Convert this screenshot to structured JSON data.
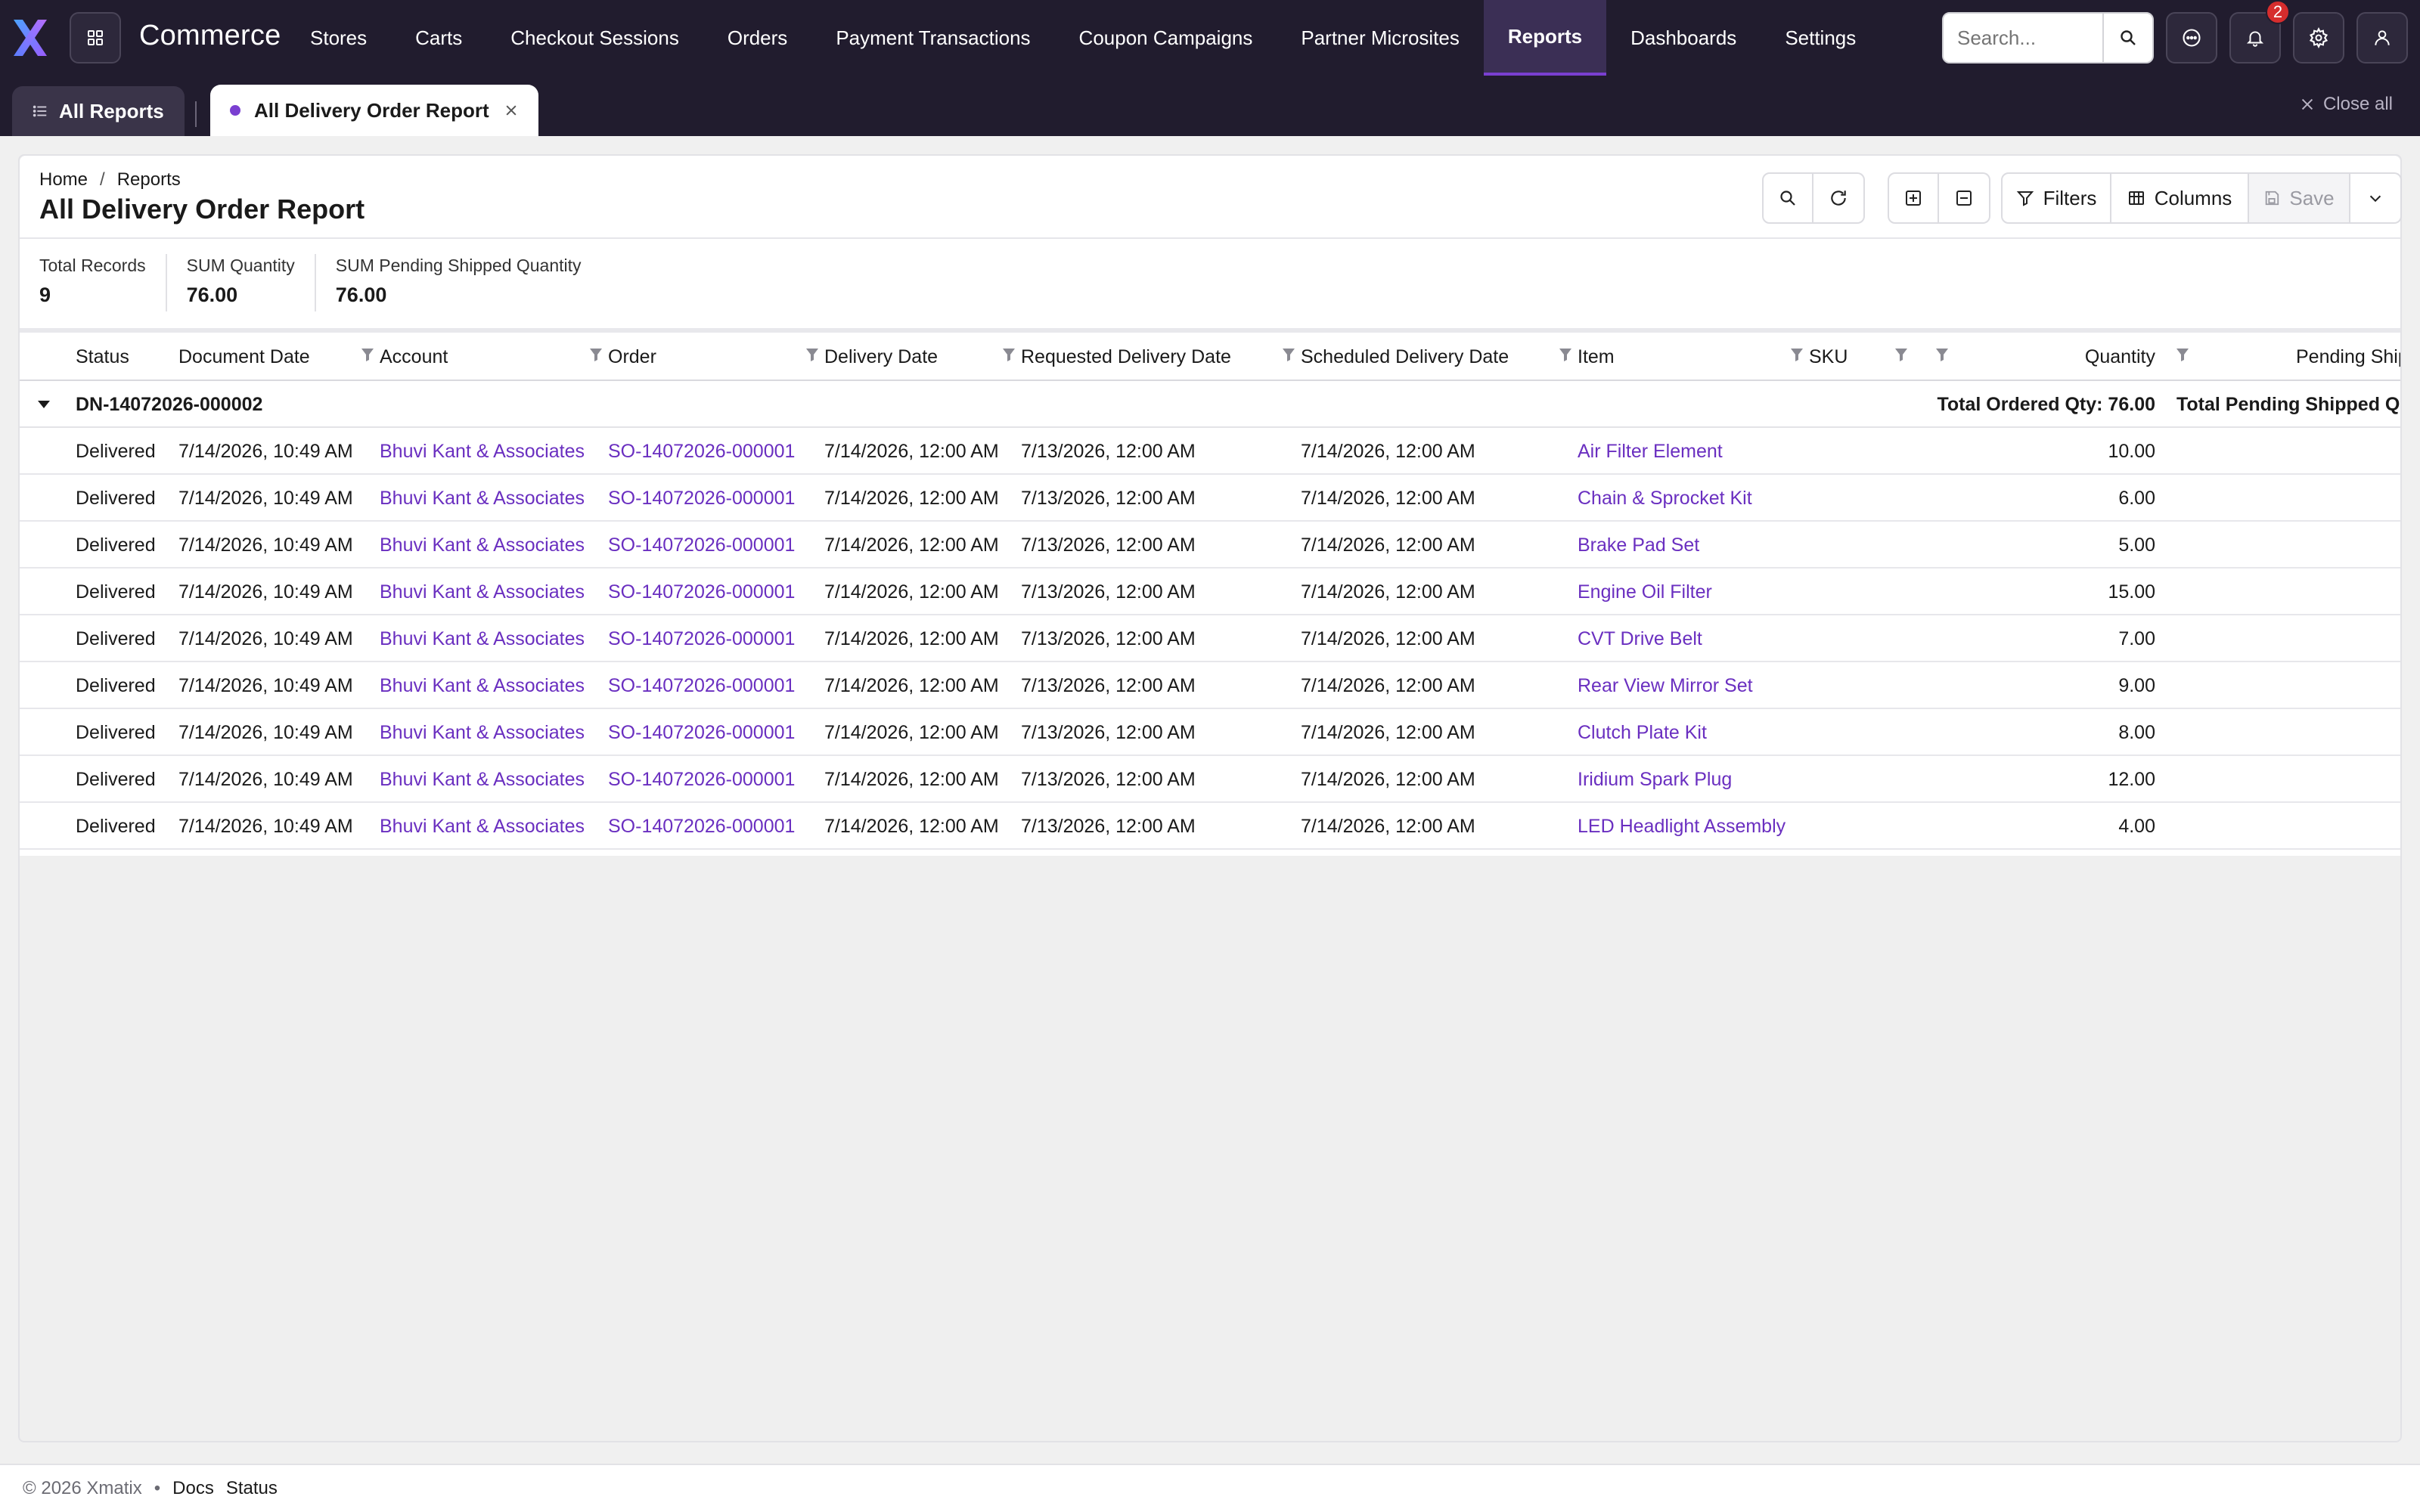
{
  "app": {
    "brand": "Commerce"
  },
  "nav": {
    "items": [
      "Stores",
      "Carts",
      "Checkout Sessions",
      "Orders",
      "Payment Transactions",
      "Coupon Campaigns",
      "Partner Microsites",
      "Reports",
      "Dashboards",
      "Settings"
    ],
    "active": "Reports"
  },
  "search": {
    "placeholder": "Search..."
  },
  "notifications": {
    "count": "2"
  },
  "tabs": {
    "all_reports": "All Reports",
    "active": "All Delivery Order Report",
    "close_all": "Close all"
  },
  "breadcrumb": {
    "home": "Home",
    "separator": "/",
    "current": "Reports"
  },
  "page": {
    "title": "All Delivery Order Report"
  },
  "toolbar": {
    "filters": "Filters",
    "columns": "Columns",
    "save": "Save"
  },
  "stats": [
    {
      "label": "Total Records",
      "value": "9"
    },
    {
      "label": "SUM Quantity",
      "value": "76.00"
    },
    {
      "label": "SUM Pending Shipped Quantity",
      "value": "76.00"
    }
  ],
  "table": {
    "columns": {
      "status": "Status",
      "document_date": "Document Date",
      "account": "Account",
      "order": "Order",
      "delivery_date": "Delivery Date",
      "requested_delivery_date": "Requested Delivery Date",
      "scheduled_delivery_date": "Scheduled Delivery Date",
      "item": "Item",
      "sku": "SKU",
      "quantity": "Quantity",
      "pending_shipped": "Pending Shipp"
    },
    "group": {
      "name": "DN-14072026-000002",
      "total_ordered": "Total Ordered Qty: 76.00",
      "total_pending": "Total Pending Shipped Quan"
    },
    "rows": [
      {
        "status": "Delivered",
        "document_date": "7/14/2026, 10:49 AM",
        "account": "Bhuvi Kant & Associates",
        "order": "SO-14072026-000001",
        "delivery_date": "7/14/2026, 12:00 AM",
        "requested": "7/13/2026, 12:00 AM",
        "scheduled": "7/14/2026, 12:00 AM",
        "item": "Air Filter Element",
        "quantity": "10.00"
      },
      {
        "status": "Delivered",
        "document_date": "7/14/2026, 10:49 AM",
        "account": "Bhuvi Kant & Associates",
        "order": "SO-14072026-000001",
        "delivery_date": "7/14/2026, 12:00 AM",
        "requested": "7/13/2026, 12:00 AM",
        "scheduled": "7/14/2026, 12:00 AM",
        "item": "Chain & Sprocket Kit",
        "quantity": "6.00"
      },
      {
        "status": "Delivered",
        "document_date": "7/14/2026, 10:49 AM",
        "account": "Bhuvi Kant & Associates",
        "order": "SO-14072026-000001",
        "delivery_date": "7/14/2026, 12:00 AM",
        "requested": "7/13/2026, 12:00 AM",
        "scheduled": "7/14/2026, 12:00 AM",
        "item": "Brake Pad Set",
        "quantity": "5.00"
      },
      {
        "status": "Delivered",
        "document_date": "7/14/2026, 10:49 AM",
        "account": "Bhuvi Kant & Associates",
        "order": "SO-14072026-000001",
        "delivery_date": "7/14/2026, 12:00 AM",
        "requested": "7/13/2026, 12:00 AM",
        "scheduled": "7/14/2026, 12:00 AM",
        "item": "Engine Oil Filter",
        "quantity": "15.00"
      },
      {
        "status": "Delivered",
        "document_date": "7/14/2026, 10:49 AM",
        "account": "Bhuvi Kant & Associates",
        "order": "SO-14072026-000001",
        "delivery_date": "7/14/2026, 12:00 AM",
        "requested": "7/13/2026, 12:00 AM",
        "scheduled": "7/14/2026, 12:00 AM",
        "item": "CVT Drive Belt",
        "quantity": "7.00"
      },
      {
        "status": "Delivered",
        "document_date": "7/14/2026, 10:49 AM",
        "account": "Bhuvi Kant & Associates",
        "order": "SO-14072026-000001",
        "delivery_date": "7/14/2026, 12:00 AM",
        "requested": "7/13/2026, 12:00 AM",
        "scheduled": "7/14/2026, 12:00 AM",
        "item": "Rear View Mirror Set",
        "quantity": "9.00"
      },
      {
        "status": "Delivered",
        "document_date": "7/14/2026, 10:49 AM",
        "account": "Bhuvi Kant & Associates",
        "order": "SO-14072026-000001",
        "delivery_date": "7/14/2026, 12:00 AM",
        "requested": "7/13/2026, 12:00 AM",
        "scheduled": "7/14/2026, 12:00 AM",
        "item": "Clutch Plate Kit",
        "quantity": "8.00"
      },
      {
        "status": "Delivered",
        "document_date": "7/14/2026, 10:49 AM",
        "account": "Bhuvi Kant & Associates",
        "order": "SO-14072026-000001",
        "delivery_date": "7/14/2026, 12:00 AM",
        "requested": "7/13/2026, 12:00 AM",
        "scheduled": "7/14/2026, 12:00 AM",
        "item": "Iridium Spark Plug",
        "quantity": "12.00"
      },
      {
        "status": "Delivered",
        "document_date": "7/14/2026, 10:49 AM",
        "account": "Bhuvi Kant & Associates",
        "order": "SO-14072026-000001",
        "delivery_date": "7/14/2026, 12:00 AM",
        "requested": "7/13/2026, 12:00 AM",
        "scheduled": "7/14/2026, 12:00 AM",
        "item": "LED Headlight Assembly",
        "quantity": "4.00"
      }
    ]
  },
  "footer": {
    "copyright": "© 2026 Xmatix",
    "dot": "•",
    "docs": "Docs",
    "status": "Status"
  },
  "colors": {
    "nav_bg": "#211c2e",
    "accent": "#7a3fd1",
    "link": "#6a2fc0",
    "badge": "#d62d2d"
  },
  "icons": [
    "logo-x",
    "apps-grid-icon",
    "search-icon",
    "chat-icon",
    "bell-icon",
    "gear-icon",
    "user-icon",
    "list-icon",
    "close-icon",
    "refresh-icon",
    "expand-icon",
    "collapse-icon",
    "filter-icon",
    "columns-icon",
    "save-icon",
    "chevron-down-icon",
    "funnel-icon",
    "caret-down-icon"
  ]
}
